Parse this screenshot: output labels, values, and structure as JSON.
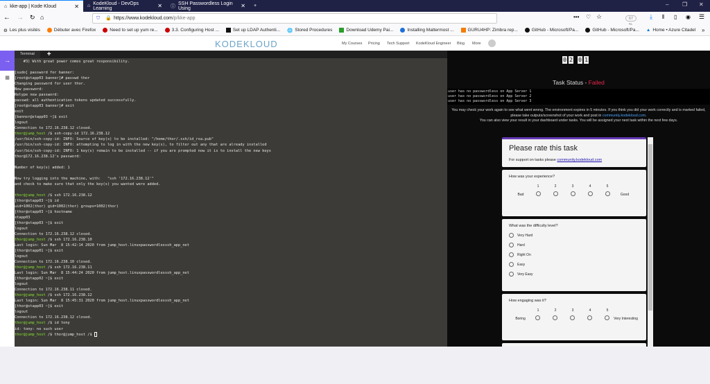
{
  "browser": {
    "tabs": [
      {
        "title": "kke-app | Kode Kloud"
      },
      {
        "title": "KodeKloud - DevOps Learning"
      },
      {
        "title": "SSH Passwordless Login Using"
      }
    ],
    "url_host": "https://www.kodekloud.com",
    "url_path": "/p/kke-app",
    "zoom": "67 %",
    "bookmarks": [
      "Les plus visités",
      "Débuter avec Firefox",
      "Need to set up yum re...",
      "3.3. Configuring Host ...",
      "Set up LDAP Authenti...",
      "Stored Procedures",
      "Download Udemy Pai...",
      "Installing Mattermost ...",
      "GURU4HP: Zimbra rep...",
      "GitHub - Microsoft/Pa...",
      "GitHub - Microsoft/Pa...",
      "Home • Azure Citadel"
    ]
  },
  "site": {
    "logo": "KODEKLOUD",
    "nav": [
      "My Courses",
      "Pricing",
      "Tech Support",
      "KodeKloud Engineer",
      "Blog",
      "More"
    ]
  },
  "terminal": {
    "tab": "Terminal",
    "prompt_user": "thor@jump_host",
    "prompt_suffix": " /$ ",
    "lines": [
      {
        "t": "    #3) With great power comes great responsibility."
      },
      {
        "t": ""
      },
      {
        "t": "[sudo] password for banner:"
      },
      {
        "t": "[root@stapp03 banner]# passwd thor"
      },
      {
        "t": "Changing password for user thor."
      },
      {
        "t": "New password:"
      },
      {
        "t": "Retype new password:"
      },
      {
        "t": "passwd: all authentication tokens updated successfully."
      },
      {
        "t": "[root@stapp03 banner]# exit"
      },
      {
        "t": "exit"
      },
      {
        "t": "[banner@stapp03 ~]$ exit"
      },
      {
        "t": "logout"
      },
      {
        "t": "Connection to 172.16.238.12 closed."
      },
      {
        "p": true,
        "t": "ssh-copy-id 172.16.238.12"
      },
      {
        "t": "/usr/bin/ssh-copy-id: INFO: Source of key(s) to be installed: \"/home/thor/.ssh/id_rsa.pub\""
      },
      {
        "t": "/usr/bin/ssh-copy-id: INFO: attempting to log in with the new key(s), to filter out any that are already installed"
      },
      {
        "t": "/usr/bin/ssh-copy-id: INFO: 1 key(s) remain to be installed -- if you are prompted now it is to install the new keys"
      },
      {
        "t": "thor@172.16.238.12's password:"
      },
      {
        "t": ""
      },
      {
        "t": "Number of key(s) added: 1"
      },
      {
        "t": ""
      },
      {
        "t": "Now try logging into the machine, with:   \"ssh '172.16.238.12'\""
      },
      {
        "t": "and check to make sure that only the key(s) you wanted were added."
      },
      {
        "t": ""
      },
      {
        "p": true,
        "t": "ssh 172.16.238.12"
      },
      {
        "t": "[thor@stapp03 ~]$ id"
      },
      {
        "t": "uid=1002(thor) gid=1002(thor) groups=1002(thor)"
      },
      {
        "t": "[thor@stapp03 ~]$ hostname"
      },
      {
        "t": "stapp03"
      },
      {
        "t": "[thor@stapp03 ~]$ exit"
      },
      {
        "t": "logout"
      },
      {
        "t": "Connection to 172.16.238.12 closed."
      },
      {
        "p": true,
        "t": "ssh 172.16.238.10"
      },
      {
        "t": "Last login: Sun Mar  8 15:42:14 2020 from jump_host.linuxpasswordlesssh_app_net"
      },
      {
        "t": "[thor@stapp01 ~]$ exit"
      },
      {
        "t": "logout"
      },
      {
        "t": "Connection to 172.16.238.10 closed."
      },
      {
        "p": true,
        "t": "ssh 172.16.238.11"
      },
      {
        "t": "Last login: Sun Mar  8 15:44:24 2020 from jump_host.linuxpasswordlesssh_app_net"
      },
      {
        "t": "[thor@stapp02 ~]$ exit"
      },
      {
        "t": "logout"
      },
      {
        "t": "Connection to 172.16.238.11 closed."
      },
      {
        "p": true,
        "t": "ssh 172.16.238.12"
      },
      {
        "t": "Last login: Sun Mar  8 15:45:31 2020 from jump_host.linuxpasswordlesssh_app_net"
      },
      {
        "t": "[thor@stapp03 ~]$ exit"
      },
      {
        "t": "logout"
      },
      {
        "t": "Connection to 172.16.238.12 closed."
      },
      {
        "p": true,
        "t": "id tony"
      },
      {
        "t": "id: tony: no such user"
      },
      {
        "p": true,
        "t": "thor@jump_host /$ ",
        "cursor": true
      }
    ]
  },
  "task": {
    "timer": [
      "0",
      "2",
      "0",
      "1"
    ],
    "status_label": "Task Status - ",
    "status_value": "Failed",
    "status_color": "#e8274b",
    "results": [
      "user has no passwordless on App Server 1",
      "user has no passwordless on App Server 2",
      "user has no passwordless on App Server 3"
    ],
    "info1": "You may check your work again to see what went wrong. The environment expires in 5 minutes. If you think you did your work correctly and is marked failed, please take outputs/screenshot of your work and post in ",
    "info_link": "community.kodekloud.com",
    "info2": "You can also view your result in your dashboard under tasks. You will be assigned your next task within the next few days."
  },
  "form": {
    "title": "Please rate this task",
    "support": "For support on tasks please ",
    "support_link": "community.kodekloud.com",
    "q1": {
      "label": "How was your experience?",
      "low": "Bad",
      "high": "Good",
      "scale": [
        "1",
        "2",
        "3",
        "4",
        "5"
      ]
    },
    "q2": {
      "label": "What was the difficulty level?",
      "options": [
        "Very Hard",
        "Hard",
        "Right On",
        "Easy",
        "Very Easy"
      ]
    },
    "q3": {
      "label": "How engaging was it?",
      "low": "Boring",
      "high": "Very Interesting",
      "scale": [
        "1",
        "2",
        "3",
        "4",
        "5"
      ]
    }
  }
}
